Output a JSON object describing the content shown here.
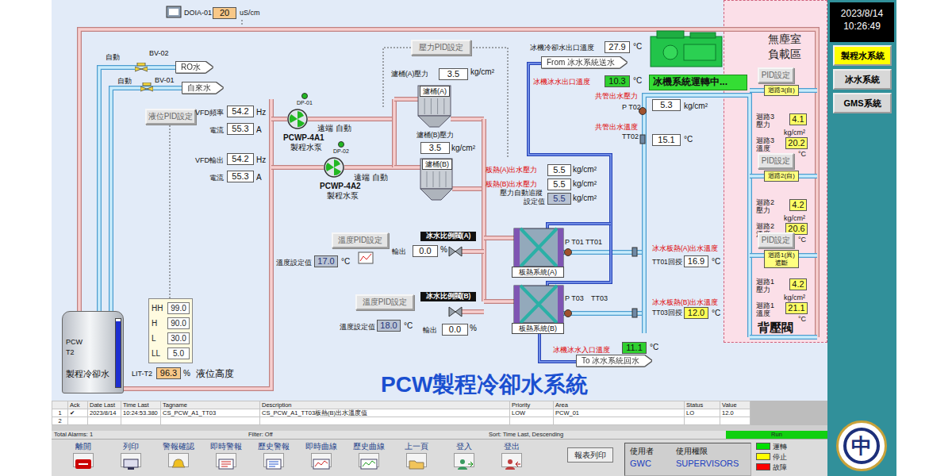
{
  "window": {
    "title": "PCW製程冷卻水系統"
  },
  "clock": {
    "date": "2023/8/14",
    "time": "10:26:49"
  },
  "nav": [
    {
      "label": "製程水系統",
      "selected": true
    },
    {
      "label": "冰水系統",
      "selected": false
    },
    {
      "label": "GMS系統",
      "selected": false
    }
  ],
  "logo": {
    "text": "中"
  },
  "valves": [
    {
      "mode": "自動",
      "name": "BV-02",
      "source": "RO水",
      "open": true
    },
    {
      "mode": "自動",
      "name": "BV-01",
      "source": "自來水",
      "open": true
    }
  ],
  "pumps": [
    {
      "tag": "DP-01",
      "name": "PCWP-4A1",
      "desc": "製程水泵",
      "mode": "遠端 自動",
      "running": true
    },
    {
      "tag": "DP-02",
      "name": "PCWP-4A2",
      "desc": "製程水泵",
      "mode": "遠端 自動",
      "running": true
    }
  ],
  "chiller": {
    "status": "冰機系統運轉中...",
    "running": true
  },
  "items": [
    {
      "kind": "label",
      "text": "DOIA-01"
    },
    {
      "kind": "meter",
      "text": "20"
    },
    {
      "kind": "label",
      "text": "uS/cm"
    },
    {
      "kind": "button",
      "text": "液位PID設定"
    },
    {
      "kind": "label",
      "text": "VFD頻率"
    },
    {
      "kind": "value",
      "text": "54.2"
    },
    {
      "kind": "unit",
      "text": "Hz"
    },
    {
      "kind": "label",
      "text": "電流"
    },
    {
      "kind": "value",
      "text": "55.3"
    },
    {
      "kind": "unit",
      "text": "A"
    },
    {
      "kind": "label",
      "text": "VFD輸出"
    },
    {
      "kind": "value",
      "text": "54.2"
    },
    {
      "kind": "unit",
      "text": "Hz"
    },
    {
      "kind": "label",
      "text": "電流"
    },
    {
      "kind": "value",
      "text": "55.3"
    },
    {
      "kind": "unit",
      "text": "A"
    },
    {
      "kind": "button",
      "text": "壓力PID設定"
    },
    {
      "kind": "label",
      "text": "濾桶(A)壓力"
    },
    {
      "kind": "value",
      "text": "3.5"
    },
    {
      "kind": "unit",
      "text": "kg/cm²"
    },
    {
      "kind": "namebox",
      "text": "濾桶(A)"
    },
    {
      "kind": "label",
      "text": "濾桶(B)壓力"
    },
    {
      "kind": "value",
      "text": "3.5"
    },
    {
      "kind": "unit",
      "text": "kg/cm²"
    },
    {
      "kind": "namebox",
      "text": "濾桶(B)"
    },
    {
      "kind": "label",
      "text": "冰機冷卻水出口溫度"
    },
    {
      "kind": "value",
      "text": "27.9"
    },
    {
      "kind": "unit",
      "text": "°C"
    },
    {
      "kind": "arrowbox",
      "text": "From 冰水系統送水"
    },
    {
      "kind": "label-red",
      "text": "冰機冰水出口溫度"
    },
    {
      "kind": "status",
      "text": "10.3"
    },
    {
      "kind": "unit",
      "text": "°C"
    },
    {
      "kind": "label-red",
      "text": "共管出水壓力"
    },
    {
      "kind": "label",
      "text": "P T02"
    },
    {
      "kind": "value",
      "text": "5.3"
    },
    {
      "kind": "unit",
      "text": "kg/cm²"
    },
    {
      "kind": "label-red",
      "text": "共管出水溫度"
    },
    {
      "kind": "label",
      "text": "TT02"
    },
    {
      "kind": "value",
      "text": "15.1"
    },
    {
      "kind": "unit",
      "text": "°C"
    },
    {
      "kind": "label-red",
      "text": "板熱(A)出水壓力"
    },
    {
      "kind": "value",
      "text": "5.5"
    },
    {
      "kind": "unit",
      "text": "kg/cm²"
    },
    {
      "kind": "label-red",
      "text": "板熱(B)出水壓力"
    },
    {
      "kind": "value",
      "text": "5.5"
    },
    {
      "kind": "unit",
      "text": "kg/cm²"
    },
    {
      "kind": "label",
      "text": "壓力自動追蹤"
    },
    {
      "kind": "label",
      "text": "設定值"
    },
    {
      "kind": "setpoint",
      "text": "5.5"
    },
    {
      "kind": "unit",
      "text": "kg/cm²"
    },
    {
      "kind": "button",
      "text": "溫度PID設定"
    },
    {
      "kind": "tagbox",
      "text": "冰水比例閥(A)"
    },
    {
      "kind": "label",
      "text": "輸出"
    },
    {
      "kind": "value",
      "text": "0.0"
    },
    {
      "kind": "unit",
      "text": "%"
    },
    {
      "kind": "label",
      "text": "溫度設定值"
    },
    {
      "kind": "setpoint",
      "text": "17.0"
    },
    {
      "kind": "unit",
      "text": "°C"
    },
    {
      "kind": "label",
      "text": "P T01 TT01"
    },
    {
      "kind": "namebox",
      "text": "板熱系統(A)"
    },
    {
      "kind": "label-red",
      "text": "冰水板熱(A)出水溫度"
    },
    {
      "kind": "label",
      "text": "TT01回授"
    },
    {
      "kind": "value",
      "text": "16.9"
    },
    {
      "kind": "unit",
      "text": "°C"
    },
    {
      "kind": "button",
      "text": "溫度PID設定"
    },
    {
      "kind": "tagbox",
      "text": "冰水比例閥(B)"
    },
    {
      "kind": "label",
      "text": "P T03"
    },
    {
      "kind": "label",
      "text": "TT03"
    },
    {
      "kind": "label-red",
      "text": "冰水板熱(B)出水溫度"
    },
    {
      "kind": "label",
      "text": "TT03回授"
    },
    {
      "kind": "alarm",
      "text": "12.0"
    },
    {
      "kind": "unit",
      "text": "°C"
    },
    {
      "kind": "label",
      "text": "溫度設定值"
    },
    {
      "kind": "setpoint",
      "text": "18.0"
    },
    {
      "kind": "unit",
      "text": "°C"
    },
    {
      "kind": "label",
      "text": "輸出"
    },
    {
      "kind": "value",
      "text": "0.0"
    },
    {
      "kind": "unit",
      "text": "%"
    },
    {
      "kind": "namebox",
      "text": "板熱系統(B)"
    },
    {
      "kind": "label-red",
      "text": "冰機冰水入口溫度"
    },
    {
      "kind": "status",
      "text": "11.1"
    },
    {
      "kind": "unit",
      "text": "°C"
    },
    {
      "kind": "arrowbox",
      "text": "To 冰水系統回水"
    },
    {
      "kind": "label",
      "text": "LIT-T2"
    },
    {
      "kind": "meter",
      "text": "96.3"
    },
    {
      "kind": "unit",
      "text": "%"
    },
    {
      "kind": "label",
      "text": "液位高度"
    }
  ],
  "tank": {
    "lines": [
      "PCW",
      "T2"
    ],
    "name": "製程冷卻水",
    "level": 0.963
  },
  "level_alarms": [
    {
      "label": "HH",
      "value": "99.0"
    },
    {
      "label": "H",
      "value": "90.0"
    },
    {
      "label": "L",
      "value": "30.0"
    },
    {
      "label": "LL",
      "value": "5.0"
    }
  ],
  "zone": {
    "title": [
      "無塵室",
      "負載區"
    ],
    "valve": "背壓閥",
    "loops": [
      {
        "pid": "PID設定",
        "name_lines": [
          "迴路3(自)"
        ],
        "pressure_label": [
          "迴路3",
          "壓力"
        ],
        "pressure": "4.1",
        "pressure_unit": "kg/cm²",
        "temp_label": [
          "迴路3",
          "溫度"
        ],
        "temp": "20.2",
        "temp_unit": "°C"
      },
      {
        "pid": "PID設定",
        "name_lines": [
          "迴路2(自)"
        ],
        "pressure_label": [
          "迴路2",
          "壓力"
        ],
        "pressure": "4.2",
        "pressure_unit": "kg/cm²",
        "temp_label": [
          "迴路2",
          "溫度"
        ],
        "temp": "20.6",
        "temp_unit": "°C"
      },
      {
        "pid": "PID設定",
        "name_lines": [
          "迴路1(異)",
          "遮斷"
        ],
        "pressure_label": [
          "迴路1",
          "壓力"
        ],
        "pressure": "4.2",
        "pressure_unit": "kg/cm²",
        "temp_label": [
          "迴路1",
          "溫度"
        ],
        "temp": "21.1",
        "temp_unit": "°C"
      }
    ]
  },
  "alarms": {
    "columns": [
      "Ack",
      "Date Last",
      "Time Last",
      "Tagname",
      "Description",
      "Priority",
      "Area",
      "Status",
      "Value"
    ],
    "rows": [
      {
        "cells": [
          "1",
          "✔",
          "2023/8/14",
          "10:24:53.380",
          "CS_PCW_A1_TT03",
          "CS_PCW_A1_TT03板熱(B)出水溫度值",
          "LOW",
          "PCW_01",
          "LO",
          "12.0"
        ]
      },
      {
        "cells": [
          "2"
        ]
      }
    ],
    "footer": {
      "total": "Total Alarms: 1",
      "filter": "Filter: Off",
      "sort": "Sort: Time Last, Descending",
      "state": "Run",
      "running": true
    }
  },
  "toolbar": [
    {
      "label": "離開"
    },
    {
      "label": "列印"
    },
    {
      "label": "警報確認"
    },
    {
      "label": "即時警報"
    },
    {
      "label": "歷史警報"
    },
    {
      "label": "即時曲線"
    },
    {
      "label": "歷史曲線"
    },
    {
      "label": "上一頁"
    },
    {
      "label": "登入"
    },
    {
      "label": "登出"
    }
  ],
  "report_button": "報表列印",
  "user": {
    "user_label": "使用者",
    "user": "GWC",
    "role_label": "使用權限",
    "role": "SUPERVISORS"
  },
  "legend": [
    {
      "label": "運轉",
      "color": "#00e000"
    },
    {
      "label": "停止",
      "color": "#ffff00"
    },
    {
      "label": "故障",
      "color": "#ff0000"
    }
  ]
}
